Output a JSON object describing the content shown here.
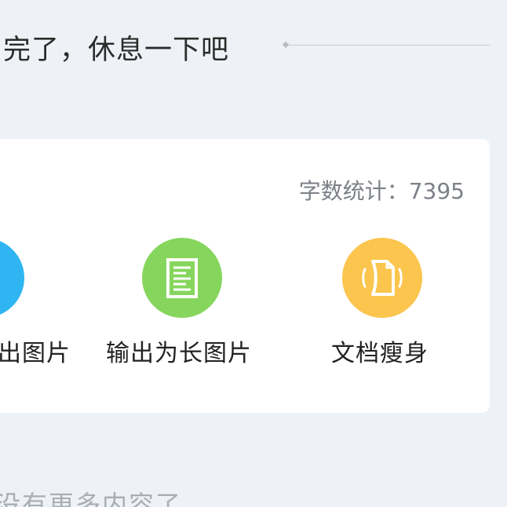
{
  "header": {
    "message": "完了，休息一下吧"
  },
  "card": {
    "word_count_label": "字数统计：",
    "word_count_value": "7395",
    "tools": [
      {
        "label": "出图片",
        "icon": "image-icon",
        "color": "#2fb6f2"
      },
      {
        "label": "输出为长图片",
        "icon": "long-image-icon",
        "color": "#86d65d"
      },
      {
        "label": "文档瘦身",
        "icon": "document-slim-icon",
        "color": "#fbc54e"
      }
    ]
  },
  "footer": {
    "message": "没有更多内容了"
  }
}
